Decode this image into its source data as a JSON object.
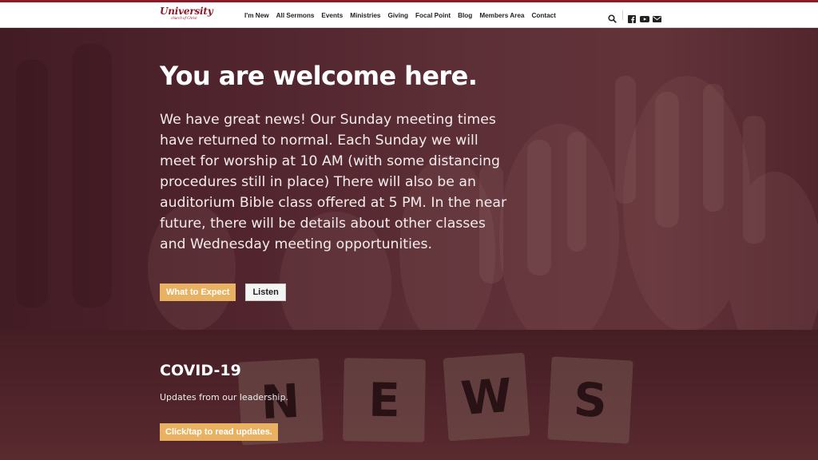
{
  "header": {
    "logo_main": "University",
    "logo_sub": "church of Christ",
    "nav": [
      "I'm New",
      "All Sermons",
      "Events",
      "Ministries",
      "Giving",
      "Focal Point",
      "Blog",
      "Members Area",
      "Contact"
    ]
  },
  "hero": {
    "title": "You are welcome here.",
    "body": "We have great news! Our Sunday meeting times have returned to normal. Each Sunday we will meet for worship at 10 AM (with some distancing procedures still in place) There will also be an auditorium Bible class offered at 5 PM. In the near future, there will be details about other classes and Wednesday meeting opportunities.",
    "primary_button": "What to Expect",
    "secondary_button": "Listen"
  },
  "covid": {
    "title": "COVID-19",
    "subtitle": "Updates from our leadership.",
    "button": "Click/tap to read updates.",
    "tiles": [
      "N",
      "E",
      "W",
      "S"
    ]
  },
  "colors": {
    "brand": "#8c1b27",
    "accent_button": "#e9b262"
  },
  "icons": [
    "search-icon",
    "facebook-icon",
    "youtube-icon",
    "email-icon"
  ]
}
